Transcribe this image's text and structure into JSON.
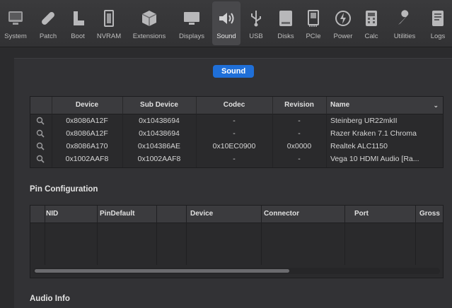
{
  "toolbar": {
    "items": [
      {
        "label": "System",
        "icon": "display-icon"
      },
      {
        "label": "Patch",
        "icon": "bandage-icon"
      },
      {
        "label": "Boot",
        "icon": "boot-icon"
      },
      {
        "label": "NVRAM",
        "icon": "chip-icon"
      },
      {
        "label": "Extensions",
        "icon": "cube-icon"
      },
      {
        "label": "Displays",
        "icon": "monitor-icon"
      },
      {
        "label": "Sound",
        "icon": "speaker-icon",
        "active": true
      },
      {
        "label": "USB",
        "icon": "usb-icon"
      },
      {
        "label": "Disks",
        "icon": "disk-icon"
      },
      {
        "label": "PCIe",
        "icon": "pcie-icon"
      },
      {
        "label": "Power",
        "icon": "power-icon"
      },
      {
        "label": "Calc",
        "icon": "calculator-icon"
      },
      {
        "label": "Utilities",
        "icon": "wrench-icon"
      },
      {
        "label": "Logs",
        "icon": "log-icon"
      }
    ]
  },
  "section": {
    "title": "Sound"
  },
  "device_table": {
    "columns": [
      "Device",
      "Sub Device",
      "Codec",
      "Revision",
      "Name"
    ],
    "rows": [
      {
        "device": "0x8086A12F",
        "sub_device": "0x10438694",
        "codec": "-",
        "revision": "-",
        "name": "Steinberg UR22mkII"
      },
      {
        "device": "0x8086A12F",
        "sub_device": "0x10438694",
        "codec": "-",
        "revision": "-",
        "name": "Razer Kraken 7.1 Chroma"
      },
      {
        "device": "0x8086A170",
        "sub_device": "0x104386AE",
        "codec": "0x10EC0900",
        "revision": "0x0000",
        "name": "Realtek ALC1150"
      },
      {
        "device": "0x1002AAF8",
        "sub_device": "0x1002AAF8",
        "codec": "-",
        "revision": "-",
        "name": "Vega 10 HDMI Audio [Ra..."
      }
    ]
  },
  "pin_config": {
    "title": "Pin Configuration",
    "columns": [
      "NID",
      "PinDefault",
      "Device",
      "Connector",
      "Port",
      "Gross"
    ]
  },
  "audio_info": {
    "title": "Audio Info"
  },
  "colors": {
    "accent": "#1f6fd8",
    "background": "#2b2b2d"
  }
}
